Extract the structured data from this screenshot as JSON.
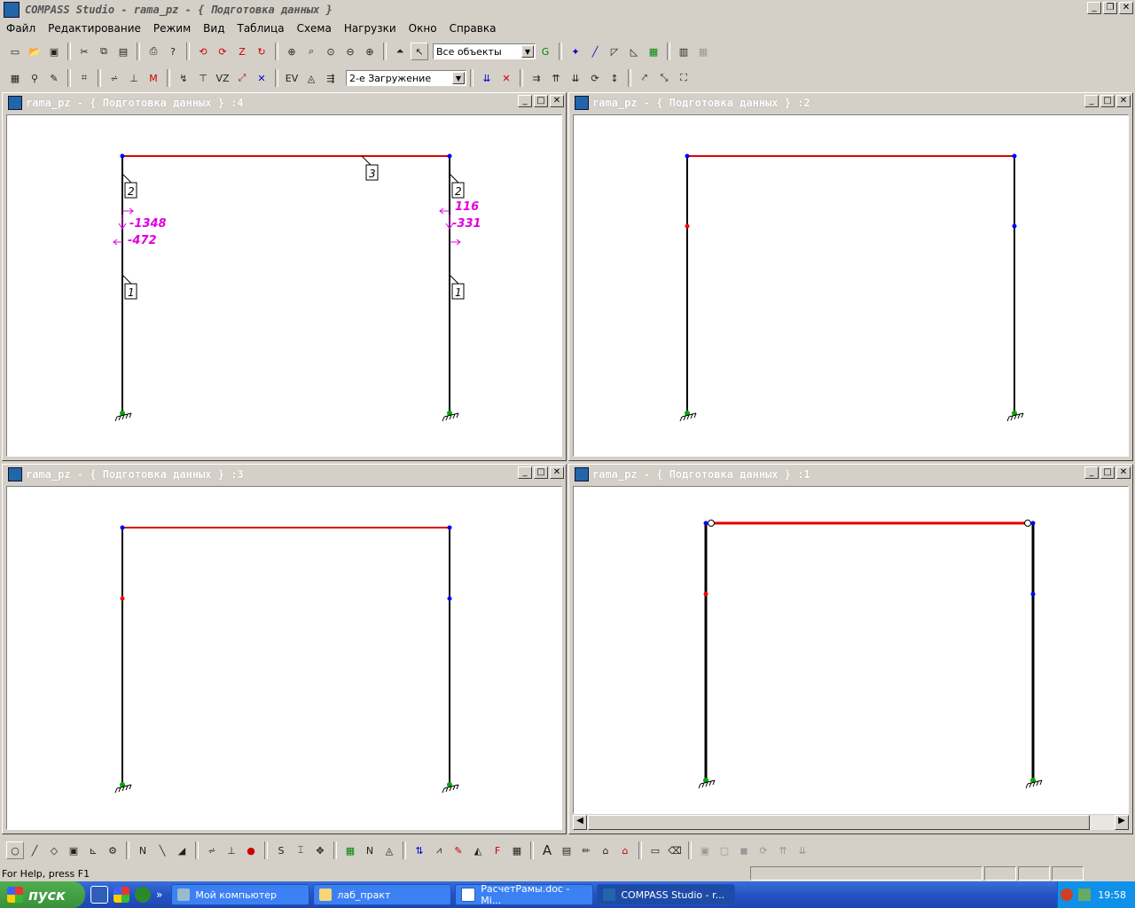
{
  "app": {
    "title": "COMPASS  Studio - rama_pz - { Подготовка данных }"
  },
  "menu": [
    "Файл",
    "Редактирование",
    "Режим",
    "Вид",
    "Таблица",
    "Схема",
    "Нагрузки",
    "Окно",
    "Справка"
  ],
  "toolbar1": {
    "objects_select": "Все объекты"
  },
  "toolbar2": {
    "load_case_select": "2-е Загружение"
  },
  "windows": [
    {
      "id": "w4",
      "title": "rama_pz - { Подготовка данных } :4",
      "labels": {
        "beam": "3",
        "col_left_upper": "2",
        "col_right_upper": "2",
        "col_left_lower": "1",
        "col_right_lower": "1"
      },
      "loads": {
        "left_top": "-1348",
        "left_bottom": "-472",
        "right_top": "116",
        "right_bottom": "-331"
      }
    },
    {
      "id": "w2",
      "title": "rama_pz - { Подготовка данных } :2"
    },
    {
      "id": "w3",
      "title": "rama_pz - { Подготовка данных } :3"
    },
    {
      "id": "w1",
      "title": "rama_pz - { Подготовка данных } :1"
    }
  ],
  "colors": {
    "beam": "#e00000",
    "column": "#000000",
    "node": "#0000ff",
    "mid_node_red": "#ff0000",
    "load": "#e000e0",
    "support": "#00aa00"
  },
  "status": {
    "help": "For Help, press F1"
  },
  "taskbar": {
    "start": "пуск",
    "tasks": [
      "Мой компьютер",
      "лаб_практ",
      "РасчетРамы.doc - Mi...",
      "COMPASS  Studio - r..."
    ],
    "clock": "19:58"
  }
}
